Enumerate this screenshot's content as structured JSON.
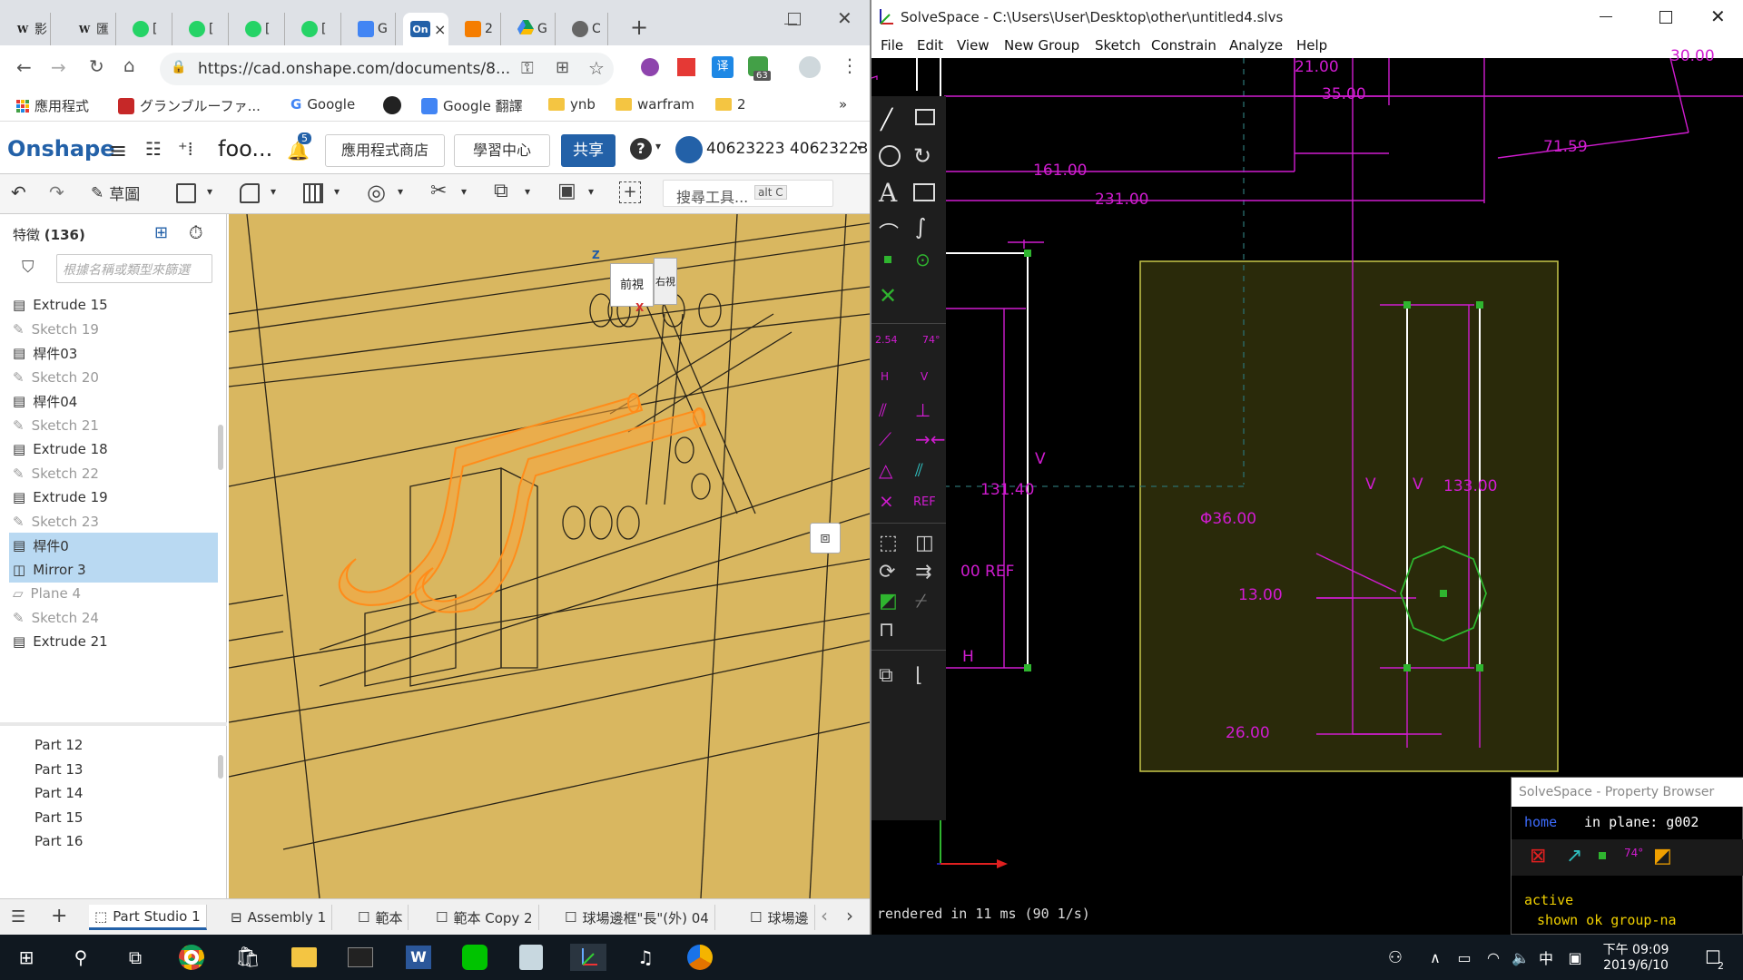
{
  "browser": {
    "tabs": [
      {
        "label": "W",
        "text": "影"
      },
      {
        "label": "W",
        "text": "匯"
      },
      {
        "label": "",
        "text": "["
      },
      {
        "label": "",
        "text": "["
      },
      {
        "label": "",
        "text": "["
      },
      {
        "label": "",
        "text": "["
      },
      {
        "label": "",
        "text": "G"
      },
      {
        "label": "On",
        "text": "×"
      },
      {
        "label": "",
        "text": "2"
      },
      {
        "label": "",
        "text": "G"
      },
      {
        "label": "",
        "text": "C"
      }
    ],
    "new_tab": "+",
    "url": "https://cad.onshape.com/documents/8...",
    "extension_badge": "63",
    "bookmarks": [
      "應用程式",
      "グランブルーファ...",
      "Google",
      "",
      "Google 翻譯",
      "ynb",
      "warfram",
      "2"
    ],
    "bookmarks_more": "»"
  },
  "onshape": {
    "logo": "Onshape",
    "doc_name": "foo...",
    "notif_count": "5",
    "app_store": "應用程式商店",
    "learning": "學習中心",
    "share": "共享",
    "help": "?",
    "user": "40623223 40623223",
    "sketch_btn": "草圖",
    "search_tools": "搜尋工具...",
    "search_shortcut": "alt C",
    "features_label": "特徵",
    "features_count": "(136)",
    "filter_placeholder": "根據名稱或類型來篩選",
    "features": [
      {
        "name": "Extrude 15",
        "kind": "extrude",
        "selected": false
      },
      {
        "name": "Sketch 19",
        "kind": "sketch",
        "selected": false
      },
      {
        "name": "桿件03",
        "kind": "extrude",
        "selected": false
      },
      {
        "name": "Sketch 20",
        "kind": "sketch",
        "selected": false
      },
      {
        "name": "桿件04",
        "kind": "extrude",
        "selected": false
      },
      {
        "name": "Sketch 21",
        "kind": "sketch",
        "selected": false
      },
      {
        "name": "Extrude 18",
        "kind": "extrude",
        "selected": false
      },
      {
        "name": "Sketch 22",
        "kind": "sketch",
        "selected": false
      },
      {
        "name": "Extrude 19",
        "kind": "extrude",
        "selected": false
      },
      {
        "name": "Sketch 23",
        "kind": "sketch",
        "selected": false
      },
      {
        "name": "桿件0",
        "kind": "extrude",
        "selected": true
      },
      {
        "name": "Mirror 3",
        "kind": "mirror",
        "selected": true
      },
      {
        "name": "Plane 4",
        "kind": "plane",
        "selected": false
      },
      {
        "name": "Sketch 24",
        "kind": "sketch",
        "selected": false
      },
      {
        "name": "Extrude 21",
        "kind": "extrude",
        "selected": false
      }
    ],
    "parts": [
      "Part 12",
      "Part 13",
      "Part 14",
      "Part 15",
      "Part 16"
    ],
    "view_cube": {
      "front": "前視",
      "right": "右視",
      "z": "Z",
      "x": "X"
    },
    "bottom_tabs": [
      "Part Studio 1",
      "Assembly 1",
      "範本",
      "範本 Copy 2",
      "球場邊框\"長\"(外) 04",
      "球場邊"
    ]
  },
  "solvespace": {
    "title": "SolveSpace - C:\\Users\\User\\Desktop\\other\\untitled4.slvs",
    "menu": [
      "File",
      "Edit",
      "View",
      "New Group",
      "Sketch",
      "Constrain",
      "Analyze",
      "Help"
    ],
    "dims": {
      "d21": "21.00",
      "d35": "35.00",
      "d30": "30.00",
      "d71": "71.59",
      "d161": "161.00",
      "d231": "231.00",
      "d131": "131.40",
      "d133": "133.00",
      "dia36": "Φ36.00",
      "d13": "13.00",
      "d26": "26.00",
      "ref": "00  REF",
      "v": "V",
      "h": "H"
    },
    "tool_labels": {
      "dim": "2.54",
      "angle": "74°",
      "ref": "REF",
      "h": "H",
      "v": "V"
    },
    "status": "rendered in 11 ms (90 1/s)",
    "prop_browser": {
      "title": "SolveSpace - Property Browser",
      "home": "home",
      "in_plane": "in plane: g002",
      "active": "active",
      "shown": "shown ok  group-na"
    }
  },
  "taskbar": {
    "time": "下午 09:09",
    "date": "2019/6/10",
    "ime": "中",
    "notif": "2"
  }
}
